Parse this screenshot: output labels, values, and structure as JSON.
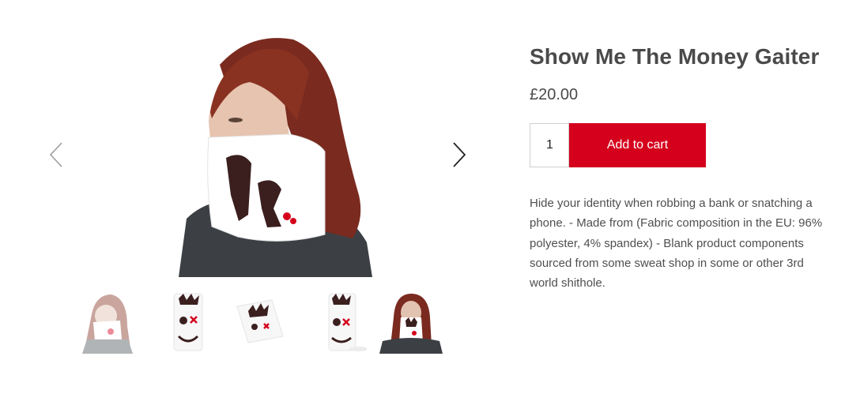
{
  "product": {
    "title": "Show Me The Money Gaiter",
    "price": "£20.00",
    "quantity": "1",
    "add_to_cart_label": "Add to cart",
    "description": "Hide your identity when robbing a bank or snatching a phone. - Made from (Fabric composition in the EU: 96% polyester, 4% spandex) - Blank product components sourced from some sweat shop in some or other 3rd world shithole."
  },
  "gallery": {
    "prev_icon": "chevron-left-icon",
    "next_icon": "chevron-right-icon",
    "thumbnails": [
      {
        "name": "thumbnail-model-side",
        "selected": false
      },
      {
        "name": "thumbnail-gaiter-front",
        "selected": false
      },
      {
        "name": "thumbnail-gaiter-flat",
        "selected": false
      },
      {
        "name": "thumbnail-gaiter-angle",
        "selected": false
      },
      {
        "name": "thumbnail-model-front",
        "selected": true
      }
    ]
  },
  "colors": {
    "accent": "#d5001c",
    "heading": "#4a4a4a",
    "body_text": "#4f4f4f",
    "hair": "#7a2a1f",
    "shirt": "#3c3f44",
    "skull": "#3b1f1f"
  }
}
